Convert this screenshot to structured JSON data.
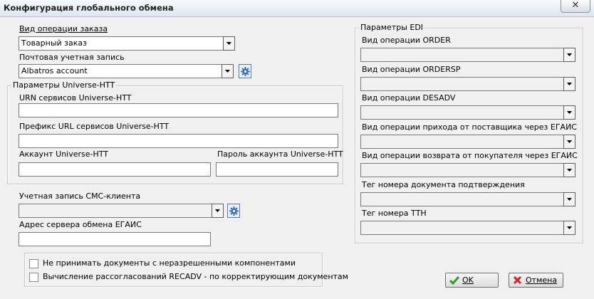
{
  "window": {
    "title": "Конфигурация глобального обмена",
    "close_glyph": "✕"
  },
  "left": {
    "order_op_label": "Вид операции заказа",
    "order_op_value": "Товарный заказ",
    "mail_account_label": "Почтовая учетная запись",
    "mail_account_value": "Albatros account",
    "universe_group": {
      "title": "Параметры Universe-HTT",
      "urn_label": "URN сервисов Universe-HTT",
      "urn_value": "",
      "url_prefix_label": "Префикс URL сервисов Universe-HTT",
      "url_prefix_value": "",
      "account_label": "Аккаунт Universe-HTT",
      "account_value": "",
      "password_label": "Пароль аккаунта Universe-HTT",
      "password_value": ""
    },
    "sms_account_label": "Учетная запись СМС-клиента",
    "sms_account_value": "",
    "egais_server_label": "Адрес сервера обмена ЕГАИС",
    "egais_server_value": "",
    "checkboxes": [
      {
        "label": "Не принимать документы с неразрешенными компонентами",
        "checked": false
      },
      {
        "label": "Вычисление рассогласований RECADV - по корректирующим документам",
        "checked": false
      }
    ]
  },
  "edi": {
    "title": "Параметры EDI",
    "fields": [
      {
        "label": "Вид операции ORDER",
        "value": ""
      },
      {
        "label": "Вид операции ORDERSP",
        "value": ""
      },
      {
        "label": "Вид операции DESADV",
        "value": ""
      },
      {
        "label": "Вид операции прихода от поставщика через ЕГАИС",
        "value": ""
      },
      {
        "label": "Вид операции возврата от покупателя через ЕГАИС",
        "value": ""
      },
      {
        "label": "Тег номера документа подтверждения",
        "value": ""
      },
      {
        "label": "Тег номера ТТН",
        "value": ""
      }
    ]
  },
  "buttons": {
    "ok": "OK",
    "cancel": "Отмена"
  },
  "icons": {
    "ok": "check-icon",
    "cancel": "x-icon",
    "settings": "gear-icon",
    "dropdown": "chevron-down-icon"
  },
  "colors": {
    "ok_check": "#2e9e2e",
    "cancel_x": "#d42020",
    "gear": "#3a6fc4"
  }
}
